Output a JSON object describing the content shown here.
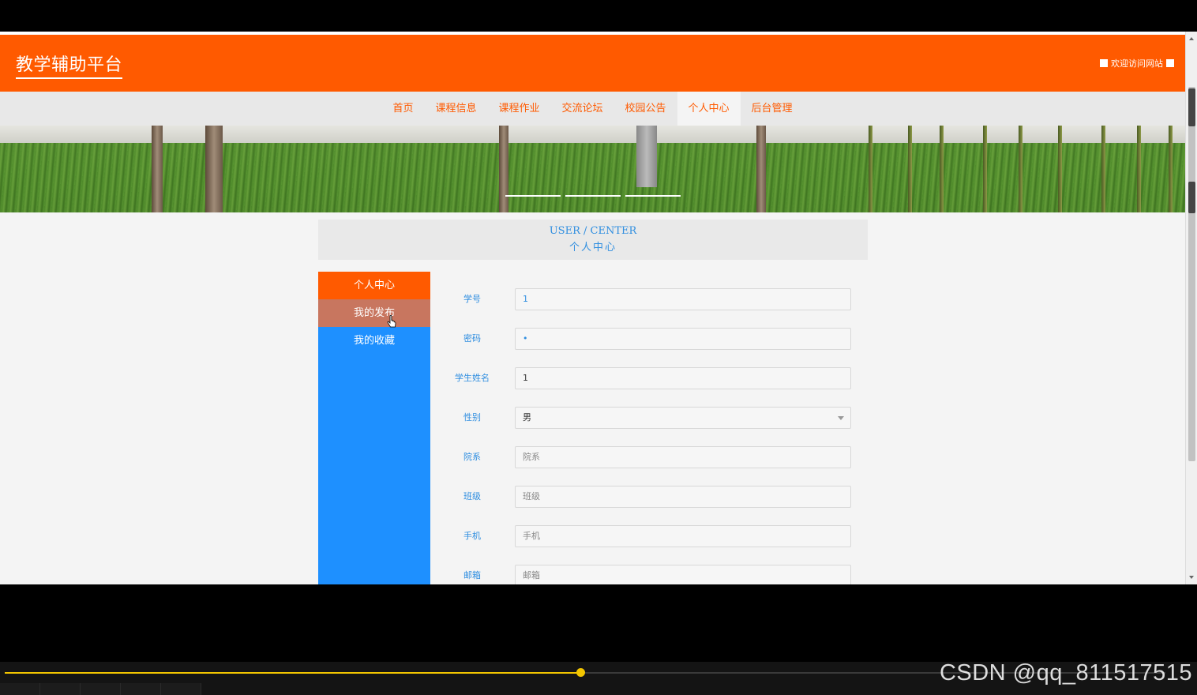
{
  "site": {
    "logo": "教学辅助平台",
    "welcome": "欢迎访问网站"
  },
  "nav": {
    "items": [
      {
        "label": "首页"
      },
      {
        "label": "课程信息"
      },
      {
        "label": "课程作业"
      },
      {
        "label": "交流论坛"
      },
      {
        "label": "校园公告"
      },
      {
        "label": "个人中心",
        "active": true
      },
      {
        "label": "后台管理"
      }
    ]
  },
  "banner": {
    "slides": 3
  },
  "section_title": {
    "en": "USER / CENTER",
    "cn": "个人中心"
  },
  "sidebar": {
    "items": [
      {
        "label": "个人中心"
      },
      {
        "label": "我的发布"
      },
      {
        "label": "我的收藏"
      }
    ]
  },
  "form": {
    "fields": [
      {
        "label": "学号",
        "value": "1"
      },
      {
        "label": "密码",
        "value": "•"
      },
      {
        "label": "学生姓名",
        "value": "1"
      },
      {
        "label": "性别",
        "value": "男"
      },
      {
        "label": "院系",
        "placeholder": "院系"
      },
      {
        "label": "班级",
        "placeholder": "班级"
      },
      {
        "label": "手机",
        "placeholder": "手机"
      },
      {
        "label": "邮箱",
        "placeholder": "邮箱"
      }
    ]
  },
  "player": {
    "progress": 0.496
  },
  "watermark": "CSDN @qq_811517515",
  "colors": {
    "brand": "#ff5a00",
    "sidebar": "#1e90ff",
    "sidebar_hover": "#c8765f",
    "label_blue": "#2f8ee0",
    "player_accent": "#f2c500"
  }
}
